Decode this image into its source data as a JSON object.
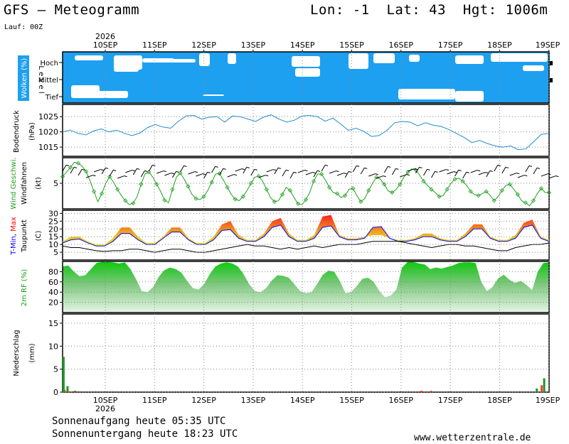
{
  "header": {
    "title": "GFS – Meteogramm",
    "location": "Lon: -1  Lat: 43  Hgt: 1006m",
    "run": "Lauf: 00Z",
    "year": "2026"
  },
  "footer": {
    "sunrise": "Sonnenaufgang heute 05:35 UTC",
    "sunset": "Sonnenuntergang heute 18:23 UTC",
    "site": "www.wetterzentrale.de"
  },
  "colors": {
    "cloud_sky": "#1ea0f0",
    "pressure": "#1e8cd2",
    "wind": "#1ea01e",
    "tmin": "#0000ff",
    "tmax": "#ff0000",
    "rh": "#14c814",
    "precip_conv": "#ff3c28",
    "precip_large": "#1e9628"
  },
  "chart_data": [
    {
      "type": "area",
      "panel": "clouds",
      "ylabel": "Wolken (%)",
      "levels": [
        "Hoch",
        "Mittel",
        "Tief"
      ],
      "level_axis_label": "L e v e l",
      "x": [
        "10SEP",
        "11SEP",
        "12SEP",
        "13SEP",
        "14SEP",
        "15SEP",
        "16SEP",
        "17SEP",
        "18SEP",
        "19SEP"
      ]
    },
    {
      "type": "line",
      "panel": "pressure",
      "ylabel": "Bodendruck",
      "unit": "(hPa)",
      "ylim": [
        1012,
        1029
      ],
      "yticks": [
        1015,
        1020,
        1025
      ],
      "values": [
        1020,
        1020.6,
        1019.5,
        1019,
        1020.3,
        1021,
        1020,
        1020.6,
        1019.5,
        1018.8,
        1019.6,
        1021.4,
        1022.4,
        1021.6,
        1021.2,
        1023.5,
        1025.2,
        1025.4,
        1024.2,
        1024.8,
        1025,
        1023.2,
        1025.2,
        1025,
        1024.2,
        1023.4,
        1024.8,
        1025.6,
        1024.2,
        1023.2,
        1023.8,
        1025.2,
        1025.4,
        1025,
        1023.5,
        1024.5,
        1022.6,
        1020.5,
        1021.2,
        1020.2,
        1018.5,
        1018.8,
        1020.5,
        1023,
        1023.4,
        1023.2,
        1022,
        1023,
        1022.2,
        1021.8,
        1020.8,
        1019.5,
        1018.2,
        1016.5,
        1017.2,
        1016.2,
        1015.4,
        1015,
        1015.4,
        1014.2,
        1014.4,
        1016.8,
        1019.2,
        1019.5
      ]
    },
    {
      "type": "line",
      "panel": "wind",
      "ylabel_1": "Wind Geschwi.",
      "ylabel_2": "Windfahnen",
      "unit": "(kt)",
      "ylim": [
        0,
        10
      ],
      "yticks": [
        5
      ],
      "values": [
        6.3,
        7.2,
        8.1,
        9.1,
        8.9,
        8.3,
        7.3,
        5.5,
        3.4,
        1.4,
        3,
        5,
        6.3,
        5.2,
        3.8,
        2.6,
        1.6,
        0.8,
        1.1,
        2.4,
        4.8,
        6.8,
        7.2,
        6.2,
        4.8,
        3.4,
        1.7,
        1.2,
        3.8,
        6.2,
        7,
        5.8,
        4.4,
        2.8,
        2,
        1.8,
        2.4,
        3.6,
        5.2,
        6.8,
        6.9,
        5.6,
        4.2,
        2.8,
        1.9,
        1.6,
        2.4,
        3.6,
        5,
        6.2,
        6.4,
        5.4,
        3.8,
        2.2,
        1.4,
        1.6,
        2.8,
        4.2,
        3.6,
        2.2,
        1,
        0.8,
        1.8,
        3.2,
        5.4,
        6.8,
        6.8,
        5.6,
        4.2,
        3.2,
        3,
        2.2,
        2.6,
        3.8,
        4,
        2.6,
        1.4,
        2,
        3.6,
        5,
        6.2,
        5.8,
        4.8,
        3.5,
        3.2,
        3.8,
        4.8,
        6.2,
        7.2,
        7.8,
        7.6,
        6.6,
        5.4,
        4.6,
        3.8,
        3.2,
        2.4,
        2.6,
        3.8,
        5,
        5.8,
        6,
        5.4,
        4.6,
        3.4,
        2.8,
        2.6,
        3,
        3.4,
        2.6,
        1.6,
        2.4,
        3.6,
        4.6,
        4.8,
        3.8,
        2.8,
        1.6,
        1.2,
        0.6,
        1.6,
        3,
        4,
        3.2,
        3.2
      ]
    },
    {
      "type": "area",
      "panel": "temperature",
      "ylabel_1": "T-Min, Max",
      "ylabel_2": "Taupunkt",
      "unit": "(C)",
      "ylim": [
        0,
        32
      ],
      "yticks": [
        5,
        10,
        15,
        20,
        25,
        30
      ],
      "series": [
        {
          "name": "T-Min",
          "values": [
            11,
            13,
            13.5,
            11,
            9,
            9,
            12,
            17,
            17,
            13,
            10,
            10,
            14,
            18,
            18,
            13,
            10,
            10,
            13,
            19,
            19.5,
            14,
            12,
            12,
            15,
            21,
            22.5,
            15,
            12,
            12,
            14,
            21,
            22,
            15,
            13,
            13,
            14,
            21,
            21.5,
            14,
            12,
            12,
            13,
            15,
            15,
            13,
            12,
            12,
            15,
            20,
            20,
            14,
            12,
            12,
            14,
            21,
            22.5,
            14,
            12
          ]
        },
        {
          "name": "Max",
          "values": [
            12,
            15,
            15,
            12,
            10,
            10,
            14,
            21,
            21,
            15,
            11,
            11,
            15,
            21,
            21,
            14,
            11,
            11,
            15,
            23,
            25,
            16,
            13,
            13,
            17,
            25,
            27,
            17,
            13,
            13,
            16,
            28,
            29,
            16,
            14,
            14,
            15,
            16,
            16,
            14,
            13,
            13,
            14,
            17,
            17,
            14,
            13,
            13,
            17,
            23,
            23,
            15,
            13,
            13,
            16,
            24,
            26,
            15,
            13
          ]
        },
        {
          "name": "Taupunkt",
          "values": [
            9,
            8,
            8,
            7,
            6,
            5.5,
            6,
            6,
            7,
            7,
            6,
            5,
            6,
            7,
            7,
            6,
            5,
            5,
            6,
            7,
            8,
            9,
            10,
            9,
            9,
            8,
            7,
            8,
            7,
            8,
            9,
            8,
            9,
            10,
            10,
            10,
            11,
            12,
            12,
            12,
            12,
            11,
            10,
            9,
            8,
            9,
            10,
            10,
            9,
            9,
            8,
            7,
            6,
            6,
            8,
            9,
            10,
            10,
            11
          ]
        }
      ]
    },
    {
      "type": "area",
      "panel": "humidity",
      "ylabel": "2m RF (%)",
      "ylim": [
        0,
        100
      ],
      "yticks": [
        20,
        40,
        60,
        80
      ],
      "values": [
        90,
        92,
        80,
        71,
        73,
        85,
        97,
        99,
        99,
        98,
        96,
        98,
        85,
        65,
        42,
        40,
        50,
        70,
        83,
        88,
        85,
        78,
        62,
        48,
        45,
        55,
        75,
        90,
        96,
        98,
        96,
        90,
        75,
        55,
        42,
        40,
        48,
        63,
        73,
        72,
        68,
        55,
        42,
        38,
        40,
        56,
        74,
        82,
        80,
        62,
        38,
        40,
        52,
        66,
        68,
        60,
        42,
        30,
        33,
        45,
        88,
        99,
        99,
        96,
        94,
        85,
        88,
        86,
        89,
        92,
        97,
        98,
        98,
        97,
        60,
        42,
        50,
        67,
        74,
        64,
        58,
        62,
        54,
        44,
        80,
        97,
        98
      ]
    },
    {
      "type": "bar",
      "panel": "precipitation",
      "ylabel": "Niederschlag",
      "unit": "(mm)",
      "ylim": [
        0,
        17
      ],
      "yticks": [
        5,
        10,
        15
      ],
      "series": [
        {
          "name": "conv",
          "values": [
            {
              "x": 0.04,
              "y": 0.5
            },
            {
              "x": 0.14,
              "y": 0.2
            },
            {
              "x": 0.3,
              "y": 0.2
            },
            {
              "x": 7.3,
              "y": 0.3
            },
            {
              "x": 7.5,
              "y": 0.3
            },
            {
              "x": 9.75,
              "y": 1.5
            }
          ]
        },
        {
          "name": "large",
          "values": [
            {
              "x": 0.02,
              "y": 7.7
            },
            {
              "x": 0.1,
              "y": 1.3
            },
            {
              "x": 0.25,
              "y": 0.3
            },
            {
              "x": 9.65,
              "y": 0.8
            },
            {
              "x": 9.8,
              "y": 3
            }
          ]
        }
      ]
    }
  ]
}
